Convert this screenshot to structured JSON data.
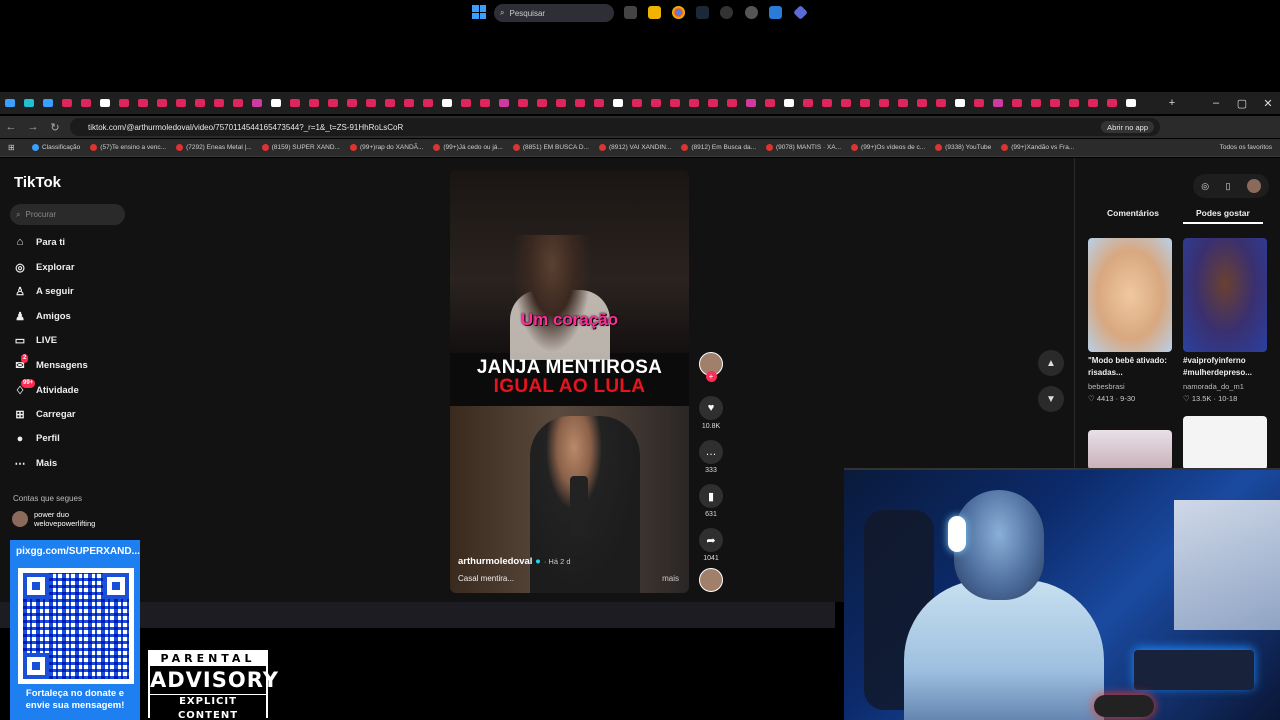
{
  "browser": {
    "url": "tiktok.com/@arthurmoledoval/video/7570114544165473544?_r=1&_t=ZS-91HhRoLsCoR",
    "open_app_label": "Abrir no app",
    "bookmarks": [
      "Classificação",
      "(57)Te ensino a venc...",
      "(7292) Eneas Metal |...",
      "(8159) SUPER XAND...",
      "(99+)rap do XANDÃ...",
      "(99+)Já cedo ou já...",
      "(8851) EM BUSCA D...",
      "(8912) VAI XANDIN...",
      "(8912) Em Busca da...",
      "(9078) MANTIS · XA...",
      "(99+)Os vídeos de c...",
      "(9338) YouTube",
      "(99+)Xandão vs Fra..."
    ],
    "favorites_label": "Todos os favoritos",
    "colors": {
      "youtube": "#e0245e",
      "accent": "#3aa0ff"
    }
  },
  "tiktok": {
    "logo": "TikTok",
    "search_placeholder": "Procurar",
    "nav": [
      {
        "label": "Para ti",
        "icon": "home-icon"
      },
      {
        "label": "Explorar",
        "icon": "compass-icon"
      },
      {
        "label": "A seguir",
        "icon": "following-icon"
      },
      {
        "label": "Amigos",
        "icon": "friends-icon"
      },
      {
        "label": "LIVE",
        "icon": "live-icon"
      },
      {
        "label": "Mensagens",
        "icon": "messages-icon"
      },
      {
        "label": "Atividade",
        "icon": "activity-icon"
      },
      {
        "label": "Carregar",
        "icon": "upload-icon"
      },
      {
        "label": "Perfil",
        "icon": "profile-icon"
      },
      {
        "label": "Mais",
        "icon": "more-icon"
      }
    ],
    "messages_badge": "2",
    "activity_badge": "99+",
    "following_title": "Contas que segues",
    "following_account": {
      "name": "power duo",
      "handle": "welovepowerlifting"
    },
    "video": {
      "caption_overlay": "Um coração",
      "title_line1": "JANJA MENTIROSA",
      "title_line2": "IGUAL AO LULA",
      "author": "arthurmoledoval",
      "time": "· Há 2 d",
      "description": "Casal mentira...",
      "more": "mais"
    },
    "actions": {
      "likes": "10.8K",
      "comments": "333",
      "saves": "631",
      "shares": "1041"
    },
    "right_panel": {
      "tab_comments": "Comentários",
      "tab_you_may_like": "Podes gostar",
      "items": [
        {
          "caption": "\"Modo bebê ativado: risadas...",
          "user": "bebesbrasi",
          "likes": "4413",
          "date": "9-30"
        },
        {
          "caption": "#vaiprofyinferno #mulherdepreso...",
          "user": "namorada_do_m1",
          "likes": "13.5K",
          "date": "10-18"
        }
      ]
    }
  },
  "taskbar": {
    "search_placeholder": "Pesquisar"
  },
  "overlay": {
    "donate_url": "pixgg.com/SUPERXAND...",
    "donate_message_line1": "Fortaleça no donate e",
    "donate_message_line2": "envie sua mensagem!",
    "parental_line1": "PARENTAL",
    "parental_line2": "ADVISORY",
    "parental_line3": "EXPLICIT CONTENT"
  }
}
